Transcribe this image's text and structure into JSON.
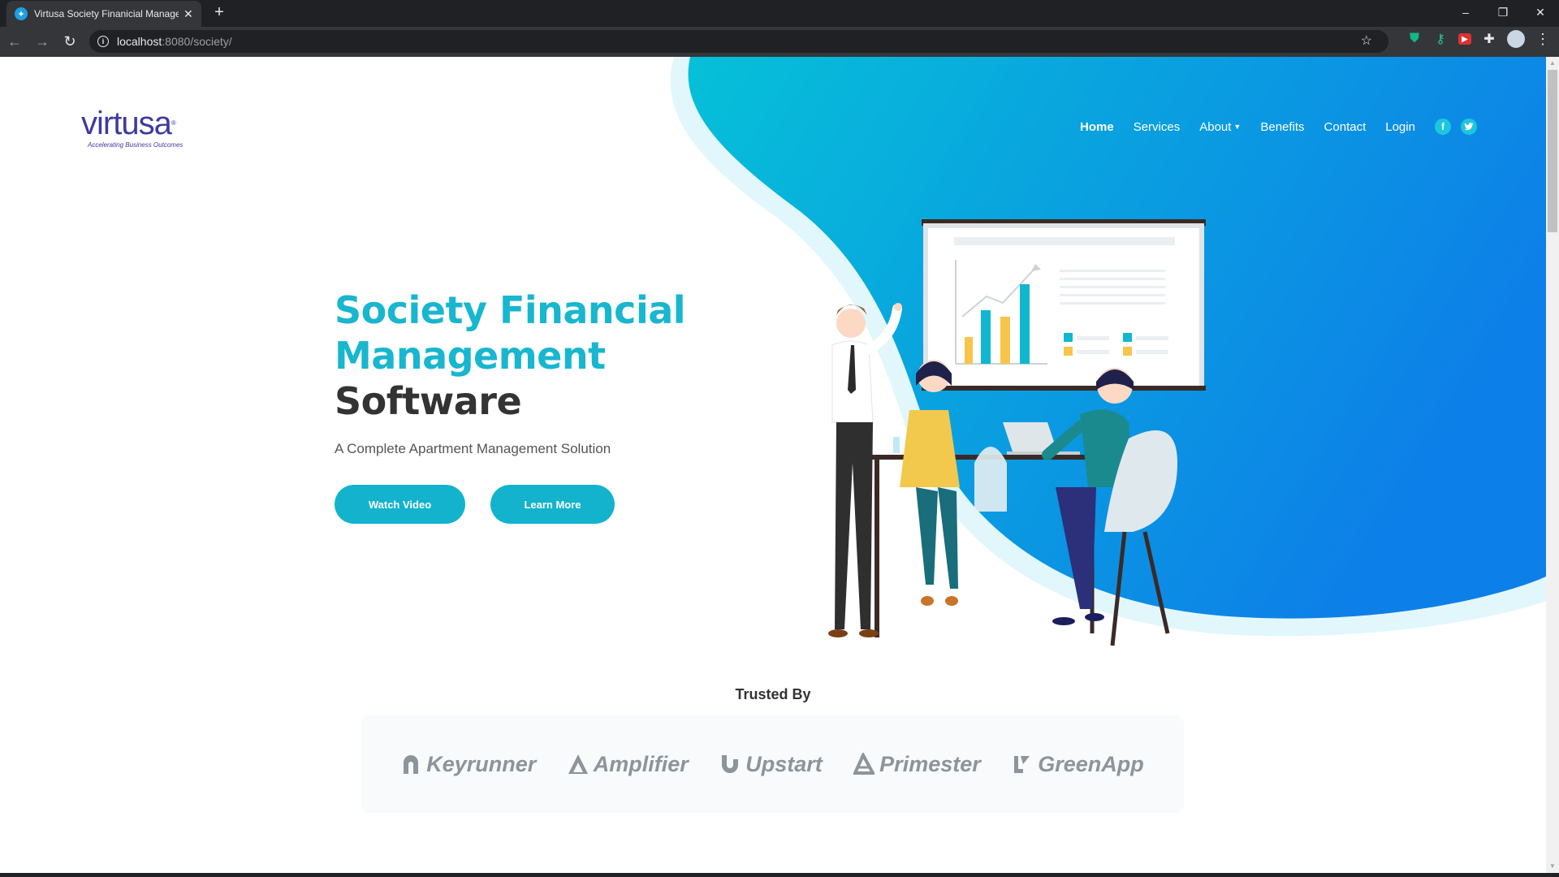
{
  "browser": {
    "tab_title": "Virtusa Society Finanicial Manage",
    "url_host": "localhost",
    "url_rest": ":8080/society/"
  },
  "site": {
    "logo_text": "virtusa",
    "logo_tagline": "Accelerating Business Outcomes",
    "nav": {
      "home": "Home",
      "services": "Services",
      "about": "About",
      "benefits": "Benefits",
      "contact": "Contact",
      "login": "Login"
    },
    "social": {
      "facebook": "f",
      "twitter": "t"
    },
    "hero": {
      "title_line1": "Society Financial",
      "title_line2": "Management",
      "title_line3": "Software",
      "subtitle": "A Complete Apartment Management Solution",
      "watch_video": "Watch Video",
      "learn_more": "Learn More"
    },
    "trusted": {
      "title": "Trusted By",
      "brands": [
        "Keyrunner",
        "Amplifier",
        "Upstart",
        "Primester",
        "GreenApp"
      ]
    }
  },
  "colors": {
    "accent": "#13b3cd",
    "title_blue": "#18b6cf",
    "title_dark": "#333333",
    "logo": "#3e3aa0",
    "hero_gradient_start": "#0ab8d4",
    "hero_gradient_end": "#0e7fe6"
  },
  "icons": {
    "tab_favicon": "blue-star-favicon",
    "back": "arrow-left-icon",
    "forward": "arrow-right-icon",
    "reload": "reload-icon",
    "info": "info-icon",
    "bookmark": "star-icon",
    "extensions": [
      "shield-extension-icon",
      "key-extension-icon",
      "youtube-extension-icon",
      "puzzle-icon",
      "profile-avatar",
      "kebab-menu-icon"
    ]
  }
}
